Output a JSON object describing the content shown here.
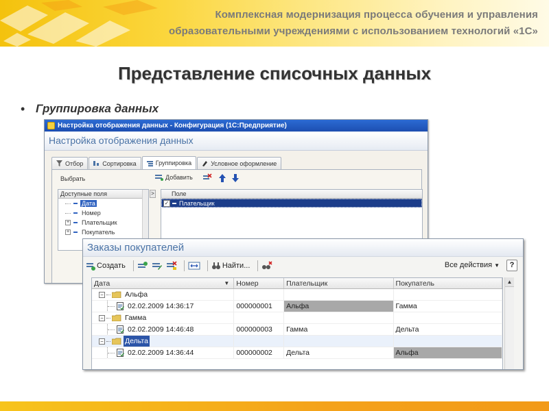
{
  "slide": {
    "banner_line1": "Комплексная модернизация процесса обучения и управления",
    "banner_line2": "образовательными учреждениями с использованием технологий «1С»",
    "title": "Представление списочных данных",
    "bullet": "Группировка данных",
    "colors": {
      "banner_yellow": "#f4c20d",
      "bottom_bar": "#f4a21a",
      "title_text": "#333333"
    }
  },
  "settings_window": {
    "title_bar": "Настройка отображения данных - Конфигурация (1С:Предприятие)",
    "header": "Настройка отображения данных",
    "tabs": [
      {
        "label": "Отбор",
        "icon": "filter-icon"
      },
      {
        "label": "Сортировка",
        "icon": "sort-icon"
      },
      {
        "label": "Группировка",
        "icon": "grouping-icon",
        "active": true
      },
      {
        "label": "Условное оформление",
        "icon": "conditional-format-icon"
      }
    ],
    "select_label": "Выбрать",
    "add_label": "Добавить",
    "available_fields_header": "Доступные поля",
    "available_fields": [
      {
        "label": "Дата",
        "expandable": false,
        "selected": true
      },
      {
        "label": "Номер",
        "expandable": false,
        "selected": false
      },
      {
        "label": "Плательщик",
        "expandable": true,
        "selected": false
      },
      {
        "label": "Покупатель",
        "expandable": true,
        "selected": false
      }
    ],
    "grouping_header": "Поле",
    "grouping_rows": [
      {
        "label": "Плательщик",
        "checked": true
      }
    ],
    "colors": {
      "title_bar": "#2b6bd4",
      "header_text": "#4a73a6",
      "selection": "#1c3d8a"
    }
  },
  "orders_window": {
    "title": "Заказы покупателей",
    "toolbar": {
      "create_label": "Создать",
      "find_label": "Найти...",
      "all_actions_label": "Все действия",
      "help_label": "?"
    },
    "columns": [
      "Дата",
      "Номер",
      "Плательщик",
      "Покупатель"
    ],
    "groups": [
      {
        "name": "Альфа",
        "rows": [
          {
            "date": "02.02.2009 14:36:17",
            "number": "000000001",
            "payer": "Альфа",
            "buyer": "Гамма"
          }
        ]
      },
      {
        "name": "Гамма",
        "rows": [
          {
            "date": "02.02.2009 14:46:48",
            "number": "000000003",
            "payer": "Гамма",
            "buyer": "Дельта"
          }
        ]
      },
      {
        "name": "Дельта",
        "rows": [
          {
            "date": "02.02.2009 14:36:44",
            "number": "000000002",
            "payer": "Дельта",
            "buyer": "Альфа"
          }
        ]
      }
    ]
  }
}
